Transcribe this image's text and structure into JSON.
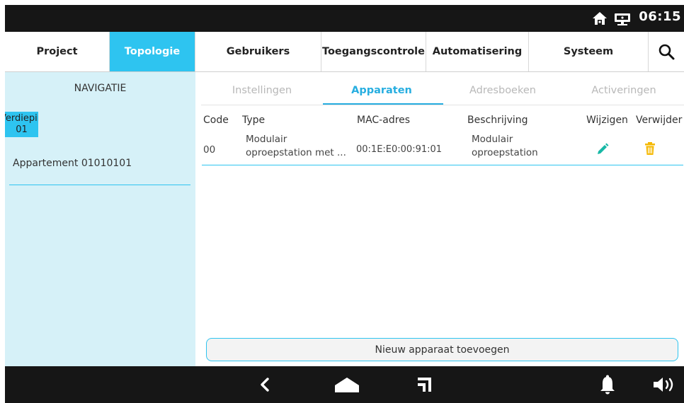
{
  "status": {
    "time": "06:15",
    "icons": [
      "home-icon",
      "network-icon"
    ]
  },
  "menu": {
    "tabs": [
      {
        "label": "Project"
      },
      {
        "label": "Topologie",
        "active": true
      },
      {
        "label": "Gebruikers"
      },
      {
        "label": "Toegangscontrole"
      },
      {
        "label": "Automatisering"
      },
      {
        "label": "Systeem"
      }
    ],
    "search_icon": "search-icon"
  },
  "nav": {
    "title": "NAVIGATIE",
    "floor_label": "Verdieping",
    "floor_number": "01",
    "apartment": "Appartement 01010101"
  },
  "subtabs": [
    {
      "label": "Instellingen"
    },
    {
      "label": "Apparaten",
      "active": true
    },
    {
      "label": "Adresboeken"
    },
    {
      "label": "Activeringen"
    }
  ],
  "table": {
    "headers": [
      "Code",
      "Type",
      "MAC-adres",
      "Beschrijving",
      "Wijzigen",
      "Verwijder"
    ],
    "rows": [
      {
        "code": "00",
        "type_line1": "Modulair",
        "type_line2": "oproepstation met ...",
        "mac": "00:1E:E0:00:91:01",
        "desc_line1": "Modulair",
        "desc_line2": "oproepstation"
      }
    ]
  },
  "add_button": "Nieuw apparaat toevoegen",
  "bottom": {
    "icons": [
      "back-icon",
      "home-icon",
      "recent-apps-icon",
      "bell-icon",
      "volume-icon"
    ]
  },
  "colors": {
    "accent": "#2ec4f0",
    "nav_bg": "#d6f1f8",
    "bar_bg": "#161616",
    "edit": "#18b8a6",
    "delete": "#f5b800"
  }
}
